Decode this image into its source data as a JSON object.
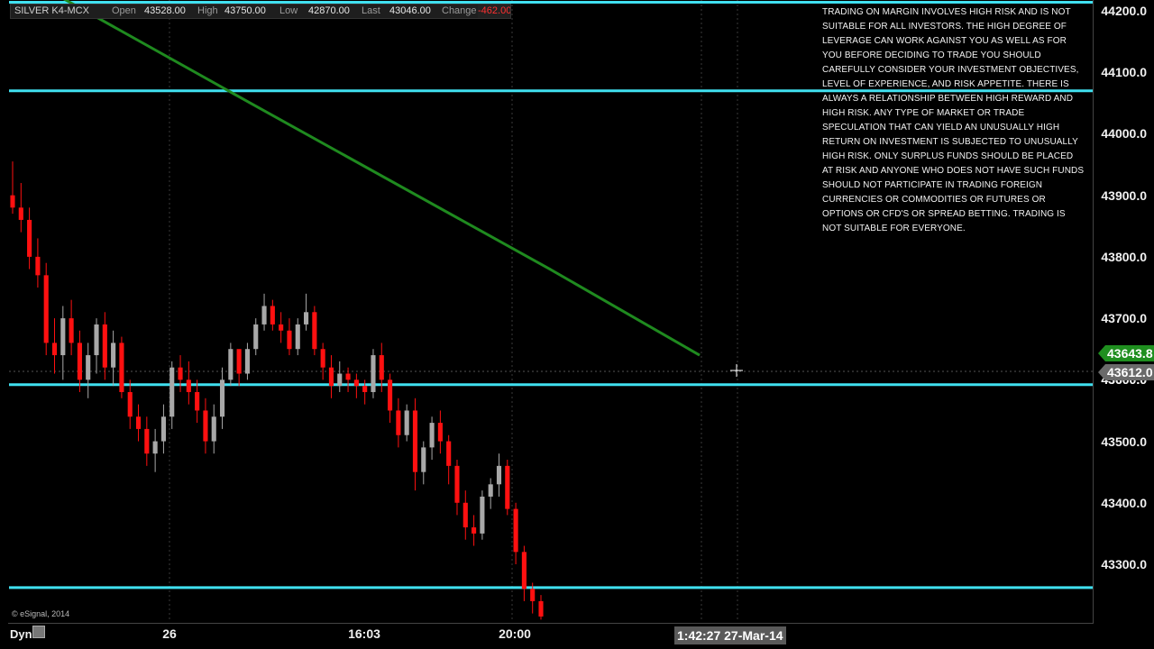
{
  "info_bar": {
    "symbol": "SILVER K4-MCX",
    "open_label": "Open",
    "open_value": "43528.00",
    "high_label": "High",
    "high_value": "43750.00",
    "low_label": "Low",
    "low_value": "42870.00",
    "last_label": "Last",
    "last_value": "43046.00",
    "change_label": "Change",
    "change_value": "-462.00"
  },
  "disclaimer": "TRADING ON MARGIN INVOLVES HIGH RISK AND IS NOT SUITABLE FOR ALL INVESTORS. THE HIGH DEGREE OF LEVERAGE CAN WORK AGAINST YOU AS WELL AS FOR YOU BEFORE DECIDING TO TRADE YOU SHOULD CAREFULLY CONSIDER YOUR INVESTMENT OBJECTIVES, LEVEL OF EXPERIENCE, AND RISK APPETITE. THERE IS ALWAYS A RELATIONSHIP BETWEEN HIGH REWARD AND HIGH RISK. ANY TYPE OF MARKET OR TRADE SPECULATION THAT CAN YIELD AN UNUSUALLY HIGH RETURN ON INVESTMENT IS SUBJECTED TO UNUSUALLY HIGH RISK. ONLY SURPLUS FUNDS SHOULD BE PLACED AT RISK AND ANYONE WHO DOES NOT HAVE SUCH FUNDS SHOULD NOT PARTICIPATE IN TRADING FOREIGN CURRENCIES OR COMMODITIES OR FUTURES OR OPTIONS OR CFD'S OR SPREAD BETTING. TRADING IS NOT SUITABLE FOR EVERYONE.",
  "copyright": "© eSignal, 2014",
  "dyn_label": "Dyn",
  "cursor_time": "1:42:27 27-Mar-14",
  "icons": {
    "dyn": "settings-icon",
    "cursor": "crosshair-icon"
  },
  "colors": {
    "background": "#000000",
    "up_candle": "#a8a8a8",
    "down_candle": "#ff1010",
    "horizontal_lines": "#40e0f0",
    "trend_line": "#1f8a1f",
    "grid": "#3a3a3a"
  },
  "chart_data": {
    "type": "candlestick",
    "y_range": [
      43210,
      44222
    ],
    "y_ticks": [
      "44200.0",
      "44100.0",
      "44000.0",
      "43900.0",
      "43800.0",
      "43700.0",
      "43600.0",
      "43500.0",
      "43400.0",
      "43300.0"
    ],
    "x_ticks": [
      "26",
      "16:03",
      "20:00"
    ],
    "price_flags": [
      {
        "label": "43643.8",
        "value": 43643.8,
        "color": "#1f8f1f"
      },
      {
        "label": "43612.0",
        "value": 43612.0,
        "color": "#6a6a6a"
      }
    ],
    "horizontal_lines": [
      44214,
      44070,
      43592,
      43262
    ],
    "trend_line": [
      [
        0,
        44220
      ],
      [
        25,
        44050
      ],
      [
        65,
        43780
      ],
      [
        85,
        43640
      ]
    ],
    "candles": [
      [
        43900,
        43955,
        43870,
        43880
      ],
      [
        43880,
        43920,
        43840,
        43860
      ],
      [
        43860,
        43880,
        43780,
        43800
      ],
      [
        43800,
        43830,
        43750,
        43770
      ],
      [
        43770,
        43790,
        43640,
        43660
      ],
      [
        43660,
        43700,
        43610,
        43640
      ],
      [
        43640,
        43720,
        43600,
        43700
      ],
      [
        43700,
        43730,
        43640,
        43660
      ],
      [
        43660,
        43680,
        43580,
        43600
      ],
      [
        43600,
        43660,
        43570,
        43640
      ],
      [
        43640,
        43700,
        43610,
        43690
      ],
      [
        43690,
        43710,
        43600,
        43620
      ],
      [
        43620,
        43680,
        43590,
        43660
      ],
      [
        43660,
        43670,
        43570,
        43580
      ],
      [
        43580,
        43600,
        43520,
        43540
      ],
      [
        43540,
        43560,
        43500,
        43520
      ],
      [
        43520,
        43540,
        43460,
        43480
      ],
      [
        43480,
        43520,
        43450,
        43500
      ],
      [
        43500,
        43560,
        43480,
        43540
      ],
      [
        43540,
        43630,
        43520,
        43620
      ],
      [
        43620,
        43640,
        43580,
        43600
      ],
      [
        43600,
        43630,
        43560,
        43580
      ],
      [
        43580,
        43600,
        43530,
        43550
      ],
      [
        43550,
        43570,
        43480,
        43500
      ],
      [
        43500,
        43560,
        43480,
        43540
      ],
      [
        43540,
        43620,
        43520,
        43600
      ],
      [
        43600,
        43660,
        43590,
        43650
      ],
      [
        43650,
        43640,
        43590,
        43610
      ],
      [
        43610,
        43660,
        43600,
        43650
      ],
      [
        43650,
        43700,
        43640,
        43690
      ],
      [
        43690,
        43740,
        43680,
        43720
      ],
      [
        43720,
        43730,
        43680,
        43690
      ],
      [
        43690,
        43710,
        43660,
        43680
      ],
      [
        43680,
        43700,
        43640,
        43650
      ],
      [
        43650,
        43700,
        43640,
        43690
      ],
      [
        43690,
        43740,
        43680,
        43710
      ],
      [
        43710,
        43720,
        43640,
        43650
      ],
      [
        43650,
        43660,
        43600,
        43620
      ],
      [
        43620,
        43640,
        43570,
        43590
      ],
      [
        43590,
        43630,
        43580,
        43610
      ],
      [
        43610,
        43620,
        43580,
        43600
      ],
      [
        43600,
        43610,
        43570,
        43590
      ],
      [
        43590,
        43600,
        43560,
        43580
      ],
      [
        43580,
        43650,
        43570,
        43640
      ],
      [
        43640,
        43660,
        43580,
        43600
      ],
      [
        43600,
        43610,
        43530,
        43550
      ],
      [
        43550,
        43570,
        43490,
        43510
      ],
      [
        43510,
        43560,
        43500,
        43550
      ],
      [
        43550,
        43570,
        43420,
        43450
      ],
      [
        43450,
        43500,
        43430,
        43490
      ],
      [
        43490,
        43540,
        43470,
        43530
      ],
      [
        43530,
        43550,
        43480,
        43500
      ],
      [
        43500,
        43510,
        43430,
        43460
      ],
      [
        43460,
        43470,
        43380,
        43400
      ],
      [
        43400,
        43420,
        43340,
        43360
      ],
      [
        43360,
        43380,
        43330,
        43350
      ],
      [
        43350,
        43420,
        43340,
        43410
      ],
      [
        43410,
        43440,
        43390,
        43430
      ],
      [
        43430,
        43480,
        43410,
        43460
      ],
      [
        43460,
        43470,
        43380,
        43390
      ],
      [
        43390,
        43400,
        43300,
        43320
      ],
      [
        43320,
        43330,
        43240,
        43260
      ],
      [
        43260,
        43270,
        43220,
        43240
      ],
      [
        43240,
        43250,
        43210,
        43215
      ]
    ]
  }
}
